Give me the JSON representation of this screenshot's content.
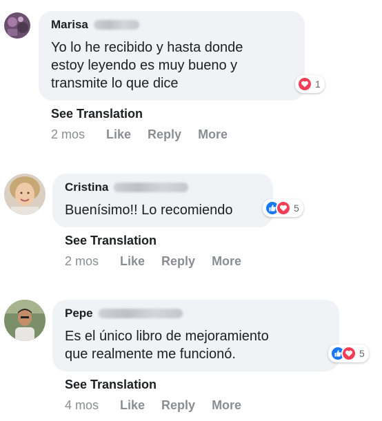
{
  "comments": [
    {
      "name": "Marisa",
      "text": "Yo lo he recibido y hasta donde\nestoy leyendo es muy bueno y\ntransmite lo que dice",
      "reaction_count": "1",
      "see_translation": "See Translation",
      "time": "2 mos",
      "like": "Like",
      "reply": "Reply",
      "more": "More"
    },
    {
      "name": "Cristina",
      "text": "Buenísimo!! Lo recomiendo",
      "reaction_count": "5",
      "see_translation": "See Translation",
      "time": "2 mos",
      "like": "Like",
      "reply": "Reply",
      "more": "More"
    },
    {
      "name": "Pepe",
      "text": "Es el único libro de mejoramiento\nque realmente me funcionó.",
      "reaction_count": "5",
      "see_translation": "See Translation",
      "time": "4 mos",
      "like": "Like",
      "reply": "Reply",
      "more": "More"
    }
  ],
  "colors": {
    "bubble": "#f0f2f5",
    "like": "#1877f2",
    "love": "#f33e58",
    "muted": "#8a8d91"
  }
}
